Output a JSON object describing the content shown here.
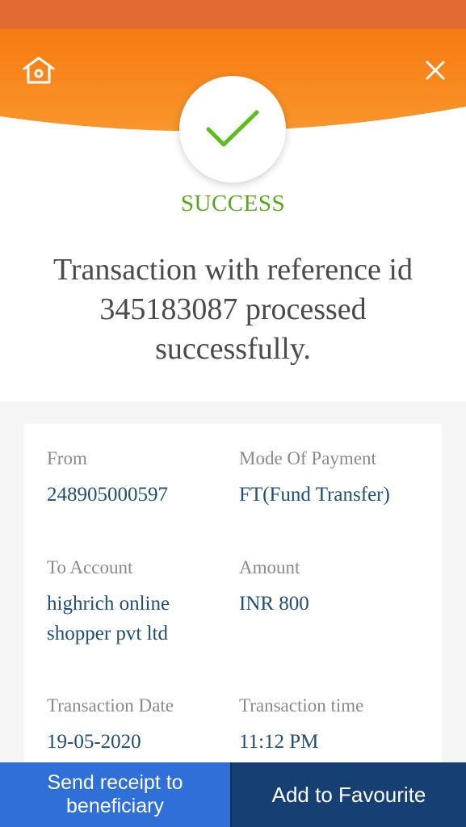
{
  "header": {
    "home_icon": "home-icon",
    "close_icon": "close-icon",
    "status_icon": "checkmark-icon",
    "accent_color": "#f57c1f",
    "success_color": "#58a81c"
  },
  "status": {
    "label": "SUCCESS",
    "message_line1": "Transaction with reference id",
    "message_line2": "345183087 processed",
    "message_line3": "successfully."
  },
  "details": {
    "from_label": "From",
    "from_value": "248905000597",
    "mode_label": "Mode Of Payment",
    "mode_value": "FT(Fund Transfer)",
    "to_label": "To Account",
    "to_value_line1": "highrich online",
    "to_value_line2": "shopper pvt ltd",
    "amount_label": "Amount",
    "amount_value": "INR 800",
    "date_label": "Transaction Date",
    "date_value": "19-05-2020",
    "time_label": "Transaction time",
    "time_value": "11:12 PM"
  },
  "actions": {
    "send_line1": "Send receipt to",
    "send_line2": "beneficiary",
    "favourite": "Add to Favourite"
  }
}
